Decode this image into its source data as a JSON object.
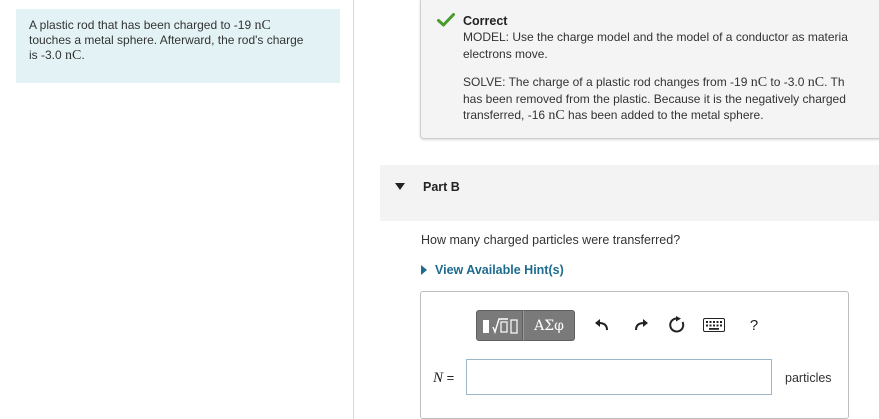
{
  "problem": {
    "line1_pre": "A plastic rod that has been charged to -19 ",
    "line1_unit": "nC",
    "line2": "touches a metal sphere. Afterward, the rod's charge",
    "line3_pre": "is -3.0 ",
    "line3_unit": "nC",
    "line3_post": "."
  },
  "feedback": {
    "title": "Correct",
    "model_line1": "MODEL: Use the charge model and the model of a conductor as materia",
    "model_line2": "electrons move.",
    "solve_l1_a": "SOLVE: The charge of a plastic rod changes from -19 ",
    "solve_l1_u1": "nC",
    "solve_l1_b": " to -3.0 ",
    "solve_l1_u2": "nC",
    "solve_l1_c": ". Th",
    "solve_l2": "has been removed from the plastic. Because it is the negatively charged",
    "solve_l3_a": "transferred, -16 ",
    "solve_l3_u": "nC",
    "solve_l3_b": " has been added to the metal sphere."
  },
  "part_b": {
    "title": "Part B",
    "question": "How many charged particles were transferred?",
    "hint_link": "View Available Hint(s)"
  },
  "toolbar": {
    "greek_label": "ΑΣφ",
    "help_label": "?"
  },
  "answer": {
    "variable": "N",
    "equals": " =",
    "value": "",
    "unit": "particles"
  },
  "colors": {
    "check": "#4a9a2c",
    "link": "#1d6b8e",
    "problem_bg": "#e3f3f5"
  }
}
